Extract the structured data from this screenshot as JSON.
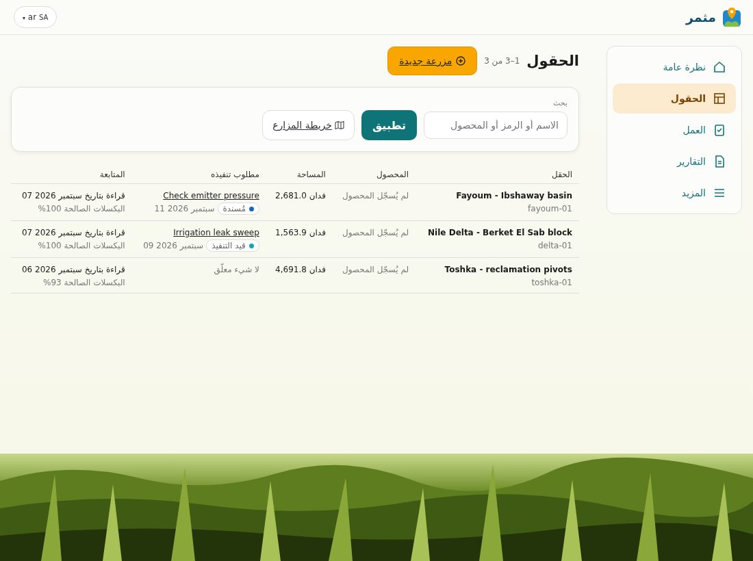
{
  "header": {
    "brand": "مثمر",
    "locale": {
      "caret": "▾",
      "lang": "ar",
      "region": "SA"
    }
  },
  "sidebar": {
    "items": [
      {
        "label": "نظرة عامة",
        "kind": "home",
        "selected": false
      },
      {
        "label": "الحقول",
        "kind": "table",
        "selected": true
      },
      {
        "label": "العمل",
        "kind": "clipboard",
        "selected": false
      },
      {
        "label": "التقارير",
        "kind": "document",
        "selected": false
      },
      {
        "label": "المزيد",
        "kind": "menu",
        "selected": false
      }
    ]
  },
  "page": {
    "title": "الحقول",
    "count": "1–3 من 3",
    "new_button": "مزرعة جديدة"
  },
  "search": {
    "label": "بحث",
    "placeholder": "الاسم أو الرمز أو المحصول",
    "apply": "تطبيق",
    "map_button": "خريطة المزارع"
  },
  "table": {
    "columns": [
      "الحقل",
      "المحصول",
      "المساحة",
      "مطلوب تنفيذه",
      "المتابعة"
    ],
    "rows": [
      {
        "name": "Fayoum - Ibshaway basin",
        "code": "fayoum-01",
        "crop": "لم يُسجّل المحصول",
        "area": "فدان 2,681.0",
        "task": {
          "kind": "task",
          "title": "Check emitter pressure",
          "status": "مُسندة",
          "color": "#1565c0",
          "date": "سبتمبر 2026 11"
        },
        "reading": "قراءة بتاريخ سبتمبر 2026 07",
        "pixels": "البكسلات الصالحة 100%"
      },
      {
        "name": "Nile Delta - Berket El Sab block",
        "code": "delta-01",
        "crop": "لم يُسجّل المحصول",
        "area": "فدان 1,563.9",
        "task": {
          "kind": "task",
          "title": "Irrigation leak sweep",
          "status": "قيد التنفيذ",
          "color": "#17a2b8",
          "date": "سبتمبر 2026 09"
        },
        "reading": "قراءة بتاريخ سبتمبر 2026 07",
        "pixels": "البكسلات الصالحة 100%"
      },
      {
        "name": "Toshka - reclamation pivots",
        "code": "toshka-01",
        "crop": "لم يُسجّل المحصول",
        "area": "فدان 4,691.8",
        "task": {
          "kind": "none",
          "text": "لا شيء معلّق"
        },
        "reading": "قراءة بتاريخ سبتمبر 2026 06",
        "pixels": "البكسلات الصالحة 93%"
      }
    ]
  }
}
